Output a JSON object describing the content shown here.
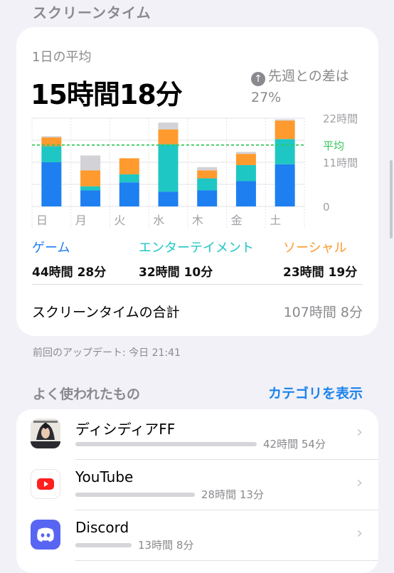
{
  "header": {
    "title": "スクリーンタイム"
  },
  "summary": {
    "avg_label": "1日の平均",
    "avg_value": "15時間18分",
    "diff_label": "先週との差は",
    "diff_value": "27%"
  },
  "colors": {
    "game": "#1e7ff0",
    "entertainment": "#1fc7c4",
    "social": "#ff9a2e",
    "other": "#d2d2d7",
    "average": "#34c759",
    "accent": "#1a83ee"
  },
  "chart_data": {
    "type": "bar",
    "stacked": true,
    "categories": [
      "日",
      "月",
      "火",
      "水",
      "木",
      "金",
      "土"
    ],
    "series": [
      {
        "name": "ゲーム",
        "values": [
          11,
          4,
          6,
          3.7,
          4,
          6.3,
          10.5
        ]
      },
      {
        "name": "エンターテイメント",
        "values": [
          4,
          1,
          2,
          11.8,
          3,
          4,
          6.3
        ]
      },
      {
        "name": "ソーシャル",
        "values": [
          2.2,
          4,
          4,
          3.7,
          2,
          2.8,
          4.6
        ]
      },
      {
        "name": "other",
        "values": [
          0.3,
          3.7,
          0,
          1.7,
          0.8,
          0.5,
          0.3
        ]
      }
    ],
    "y_ticks": [
      "0",
      "11時間",
      "22時間"
    ],
    "ylim": [
      0,
      22
    ],
    "average_label": "平均",
    "average_value": 15.3
  },
  "legend": {
    "game": {
      "label": "ゲーム",
      "time": "44時間 28分"
    },
    "entertainment": {
      "label": "エンターテイメント",
      "time": "32時間 10分"
    },
    "social": {
      "label": "ソーシャル",
      "time": "23時間 19分"
    }
  },
  "total": {
    "label": "スクリーンタイムの合計",
    "value": "107時間 8分"
  },
  "updated": "前回のアップデート: 今日 21:41",
  "most_used": {
    "title": "よく使われたもの",
    "action": "カテゴリを表示"
  },
  "apps": [
    {
      "name": "ディシディアFF",
      "time": "42時間 54分",
      "fraction": 1.0,
      "icon": "dissidia-ff-icon"
    },
    {
      "name": "YouTube",
      "time": "28時間 13分",
      "fraction": 0.66,
      "icon": "youtube-icon"
    },
    {
      "name": "Discord",
      "time": "13時間 8分",
      "fraction": 0.31,
      "icon": "discord-icon"
    }
  ]
}
